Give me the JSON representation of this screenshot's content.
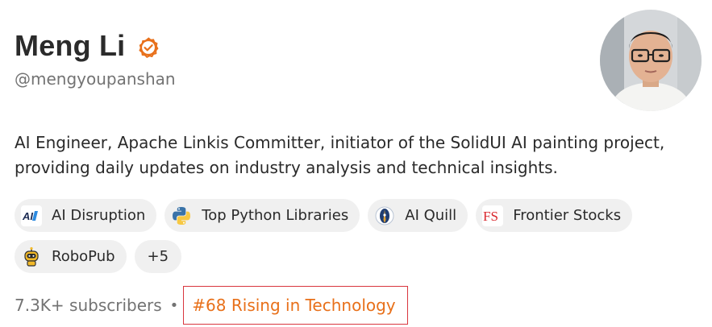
{
  "profile": {
    "name": "Meng Li",
    "handle": "@mengyoupanshan",
    "verified": true,
    "accent_color": "#e8701a",
    "bio": "AI Engineer, Apache Linkis Committer, initiator of the SolidUI AI painting project, providing daily updates on industry analysis and technical insights."
  },
  "publications": [
    {
      "label": "AI Disruption",
      "icon": "ai-disruption-logo-icon"
    },
    {
      "label": "Top Python Libraries",
      "icon": "python-logo-icon"
    },
    {
      "label": "AI Quill",
      "icon": "quill-badge-icon"
    },
    {
      "label": "Frontier Stocks",
      "icon": "fs-logo-icon"
    },
    {
      "label": "RoboPub",
      "icon": "robot-icon"
    }
  ],
  "more_publications": "+5",
  "stats": {
    "subscribers": "7.3K+ subscribers",
    "separator": "•",
    "rank": "#68 Rising in Technology"
  }
}
